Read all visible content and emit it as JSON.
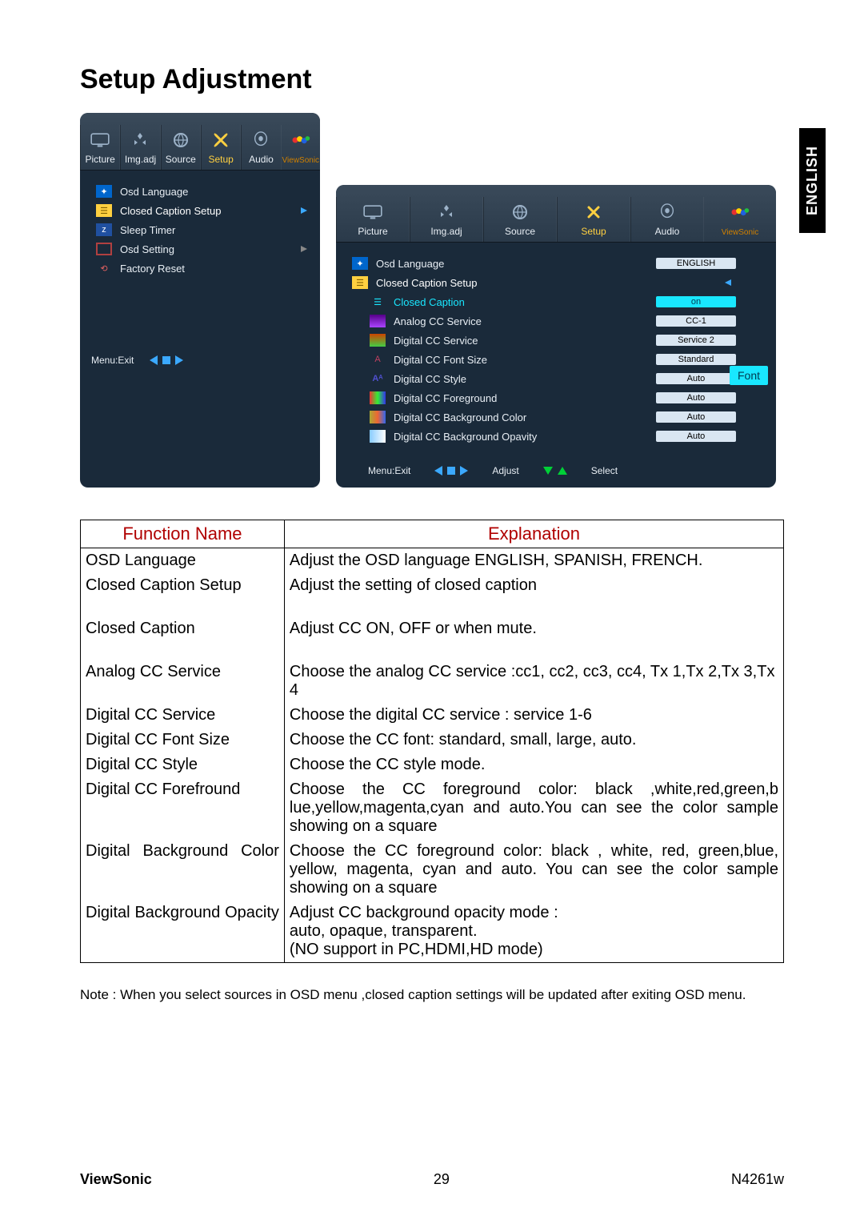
{
  "page_title": "Setup Adjustment",
  "language_tab": "ENGLISH",
  "tabs": [
    "Picture",
    "Img.adj",
    "Source",
    "Setup",
    "Audio"
  ],
  "brand": "ViewSonic",
  "left_menu": {
    "items": [
      {
        "label": "Osd Language"
      },
      {
        "label": "Closed Caption Setup",
        "selected": true
      },
      {
        "label": "Sleep Timer"
      },
      {
        "label": "Osd Setting"
      },
      {
        "label": "Factory Reset"
      }
    ],
    "footer": "Menu:Exit"
  },
  "right_menu": {
    "header": [
      {
        "label": "Osd Language",
        "value": "ENGLISH"
      },
      {
        "label": "Closed Caption Setup"
      }
    ],
    "items": [
      {
        "label": "Closed Caption",
        "value": "on",
        "highlight": true
      },
      {
        "label": "Analog CC Service",
        "value": "CC-1"
      },
      {
        "label": "Digital CC Service",
        "value": "Service 2"
      },
      {
        "label": "Digital CC  Font Size",
        "value": "Standard"
      },
      {
        "label": "Digital CC  Style",
        "value": "Auto"
      },
      {
        "label": "Digital CC  Foreground",
        "value": "Auto"
      },
      {
        "label": "Digital CC Background Color",
        "value": "Auto"
      },
      {
        "label": "Digital CC Background  Opavity",
        "value": "Auto"
      }
    ],
    "footer": {
      "menu": "Menu:Exit",
      "adjust": "Adjust",
      "select": "Select"
    },
    "tooltip": "Font"
  },
  "table": {
    "headers": [
      "Function Name",
      "Explanation"
    ],
    "rows": [
      {
        "name": "OSD Language",
        "exp": "Adjust the OSD language  ENGLISH, SPANISH, FRENCH.",
        "justify_name": false,
        "justify_exp": true
      },
      {
        "name": "Closed Caption Setup",
        "exp": "Adjust the setting of closed caption",
        "spacer": true
      },
      {
        "name": "Closed Caption",
        "exp": "Adjust CC ON, OFF or when mute.",
        "spacer": true
      },
      {
        "name": "Analog CC Service",
        "exp": "Choose the analog CC service :cc1, cc2, cc3, cc4, Tx 1,Tx 2,Tx 3,Tx 4"
      },
      {
        "name": "Digital CC Service",
        "exp": "Choose the digital CC service : service 1-6"
      },
      {
        "name": "Digital CC Font Size",
        "exp": "Choose the CC font: standard, small, large, auto."
      },
      {
        "name": "Digital CC Style",
        "exp": "Choose the CC style mode."
      },
      {
        "name": "Digital CC Forefround",
        "exp": "Choose the CC foreground color: black ,white,red,green,b lue,yellow,magenta,cyan and auto.You can see the color sample showing on a square",
        "justify_exp": true
      },
      {
        "name": "Digital Background Color",
        "exp": "Choose the CC foreground color: black , white, red, green,blue, yellow, magenta, cyan and auto. You can see the color sample showing on a square",
        "justify_name": true,
        "justify_exp": true
      },
      {
        "name": "Digital Background Opacity",
        "exp": "Adjust CC background opacity mode : \n   auto, opaque, transparent.\n(NO support in PC,HDMI,HD mode)",
        "justify_name": true
      }
    ]
  },
  "note": "Note : When you select sources in OSD menu ,closed caption settings will be updated after exiting OSD menu.",
  "footer": {
    "brand": "ViewSonic",
    "page": "29",
    "model": "N4261w"
  }
}
